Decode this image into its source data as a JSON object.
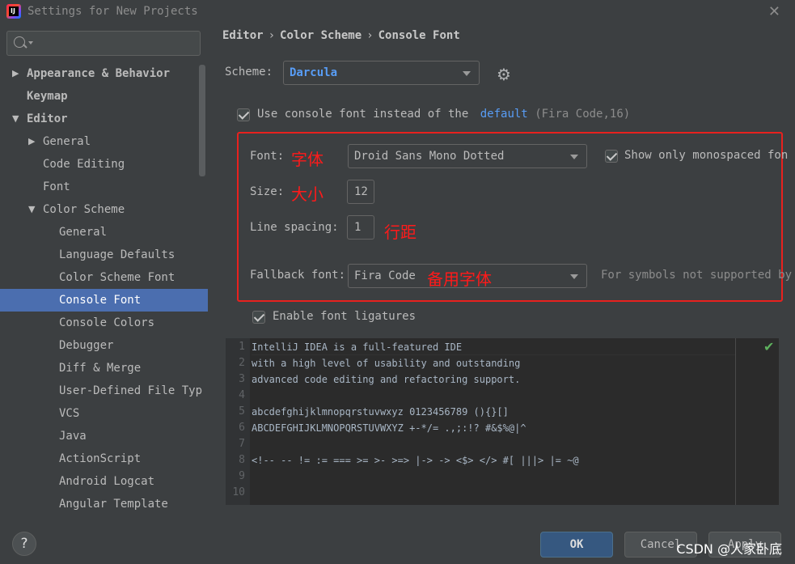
{
  "window": {
    "title": "Settings for New Projects",
    "close_glyph": "✕"
  },
  "search": {
    "placeholder": "",
    "value": ""
  },
  "sidebar": {
    "items": [
      {
        "label": "Appearance & Behavior",
        "arrow": "▶"
      },
      {
        "label": "Keymap",
        "arrow": ""
      },
      {
        "label": "Editor",
        "arrow": "▼"
      },
      {
        "label": "General",
        "arrow": "▶"
      },
      {
        "label": "Code Editing",
        "arrow": ""
      },
      {
        "label": "Font",
        "arrow": ""
      },
      {
        "label": "Color Scheme",
        "arrow": "▼"
      },
      {
        "label": "General",
        "arrow": ""
      },
      {
        "label": "Language Defaults",
        "arrow": ""
      },
      {
        "label": "Color Scheme Font",
        "arrow": ""
      },
      {
        "label": "Console Font",
        "arrow": "",
        "selected": true
      },
      {
        "label": "Console Colors",
        "arrow": ""
      },
      {
        "label": "Debugger",
        "arrow": ""
      },
      {
        "label": "Diff & Merge",
        "arrow": ""
      },
      {
        "label": "User-Defined File Typ",
        "arrow": ""
      },
      {
        "label": "VCS",
        "arrow": ""
      },
      {
        "label": "Java",
        "arrow": ""
      },
      {
        "label": "ActionScript",
        "arrow": ""
      },
      {
        "label": "Android Logcat",
        "arrow": ""
      },
      {
        "label": "Angular Template",
        "arrow": ""
      }
    ]
  },
  "breadcrumb": [
    "Editor",
    "Color Scheme",
    "Console Font"
  ],
  "breadcrumb_sep": "›",
  "scheme": {
    "label": "Scheme:",
    "value": "Darcula",
    "gear_icon": "gear-icon"
  },
  "use_console_font": {
    "prefix": "Use console font instead of the",
    "link": "default",
    "suffix": "(Fira Code,16)",
    "checked": true
  },
  "font": {
    "label": "Font:",
    "value": "Droid Sans Mono Dotted",
    "annotation": "字体"
  },
  "monospaced": {
    "label": "Show only monospaced fon",
    "checked": true
  },
  "size": {
    "label": "Size:",
    "value": "12",
    "annotation": "大小"
  },
  "line_spacing": {
    "label": "Line spacing:",
    "value": "1",
    "annotation": "行距"
  },
  "fallback": {
    "label": "Fallback font:",
    "value": "Fira Code",
    "annotation": "备用字体",
    "hint": "For symbols not supported by"
  },
  "ligatures": {
    "label": "Enable font ligatures",
    "checked": true
  },
  "preview": {
    "lines": [
      {
        "num": "1",
        "text": "IntelliJ IDEA is a full-featured IDE"
      },
      {
        "num": "2",
        "text": "with a high level of usability and outstanding"
      },
      {
        "num": "3",
        "text": "advanced code editing and refactoring support."
      },
      {
        "num": "4",
        "text": ""
      },
      {
        "num": "5",
        "text": "abcdefghijklmnopqrstuvwxyz 0123456789 (){}[]"
      },
      {
        "num": "6",
        "text": "ABCDEFGHIJKLMNOPQRSTUVWXYZ +-*/= .,;:!? #&$%@|^"
      },
      {
        "num": "7",
        "text": ""
      },
      {
        "num": "8",
        "text": "<!-- -- != := === >= >- >=> |-> -> <$> </> #[ |||> |= ~@"
      },
      {
        "num": "9",
        "text": ""
      },
      {
        "num": "10",
        "text": ""
      }
    ],
    "status_glyph": "✔"
  },
  "footer": {
    "help": "?",
    "ok": "OK",
    "cancel": "Cancel",
    "apply": "Apply",
    "watermark": "CSDN @人家卧底"
  },
  "colors": {
    "background": "#3c3f41",
    "selection": "#4b6eaf",
    "link": "#589df6",
    "annotation_red": "#e8211e",
    "editor_bg": "#2b2b2b",
    "primary_button": "#365880"
  }
}
